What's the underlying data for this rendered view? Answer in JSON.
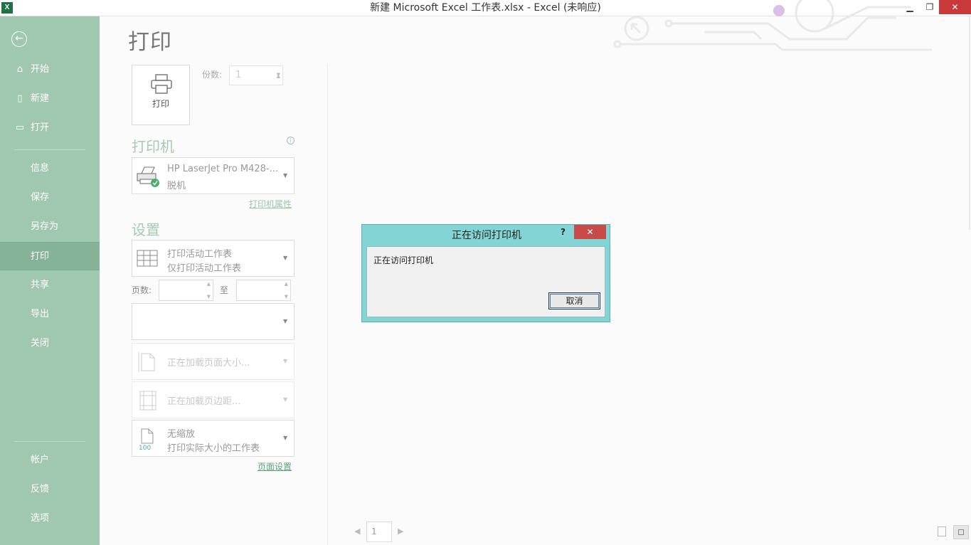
{
  "window": {
    "title": "新建 Microsoft Excel 工作表.xlsx - Excel (未响应)",
    "app_icon": "X",
    "minimize": "▁",
    "restore": "❐",
    "close": "✕"
  },
  "sidebar": {
    "back_icon": "←",
    "items": [
      {
        "label": "开始",
        "icon": "⌂"
      },
      {
        "label": "新建",
        "icon": "▯"
      },
      {
        "label": "打开",
        "icon": "▭"
      },
      {
        "label": "信息"
      },
      {
        "label": "保存"
      },
      {
        "label": "另存为"
      },
      {
        "label": "打印",
        "active": true
      },
      {
        "label": "共享"
      },
      {
        "label": "导出"
      },
      {
        "label": "关闭"
      },
      {
        "label": "帐户"
      },
      {
        "label": "反馈"
      },
      {
        "label": "选项"
      }
    ]
  },
  "print": {
    "title": "打印",
    "button_label": "打印",
    "copies_label": "份数:",
    "copies_value": "1"
  },
  "printer": {
    "heading": "打印机",
    "name": "HP LaserJet Pro M428-...",
    "status": "脱机",
    "properties_link": "打印机属性"
  },
  "settings": {
    "heading": "设置",
    "scope_main": "打印活动工作表",
    "scope_sub": "仅打印活动工作表",
    "pages_label": "页数:",
    "to_label": "至",
    "paper_size": "正在加载页面大小...",
    "margins": "正在加载页边距...",
    "scaling_main": "无缩放",
    "scaling_sub": "打印实际大小的工作表",
    "scaling_icon_text": "100",
    "page_setup_link": "页面设置"
  },
  "dialog": {
    "title": "正在访问打印机",
    "help": "?",
    "close": "✕",
    "message": "正在访问打印机",
    "cancel": "取消"
  },
  "preview": {
    "page_number": "1",
    "prev": "◀",
    "next": "▶"
  },
  "colors": {
    "sidebar": "#a0c8b0",
    "accent": "#5ea37a",
    "dialog_frame": "#82d4d5",
    "close_red": "#c7393a"
  }
}
